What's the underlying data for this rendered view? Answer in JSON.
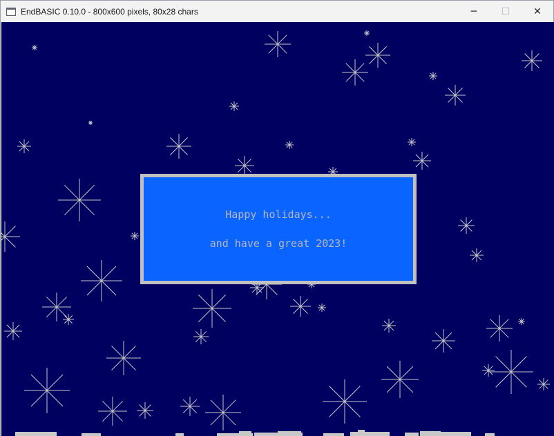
{
  "window": {
    "title": "EndBASIC 0.10.0 - 800x600 pixels, 80x28 chars",
    "icons": {
      "app": "app-window-icon",
      "minimize": "minimize-icon",
      "maximize": "maximize-icon",
      "close": "close-icon"
    },
    "controls": {
      "minimize": "─",
      "maximize": "☐",
      "close": "✕"
    }
  },
  "screen": {
    "background_color": "#000060",
    "snow_color": "#c8c8c8"
  },
  "message": {
    "line1": "Happy holidays...",
    "line2": "and have a great 2023!",
    "box_color": "#0a64ff",
    "border_color": "#c0c0c0",
    "text_color": "#b8b8b8"
  }
}
